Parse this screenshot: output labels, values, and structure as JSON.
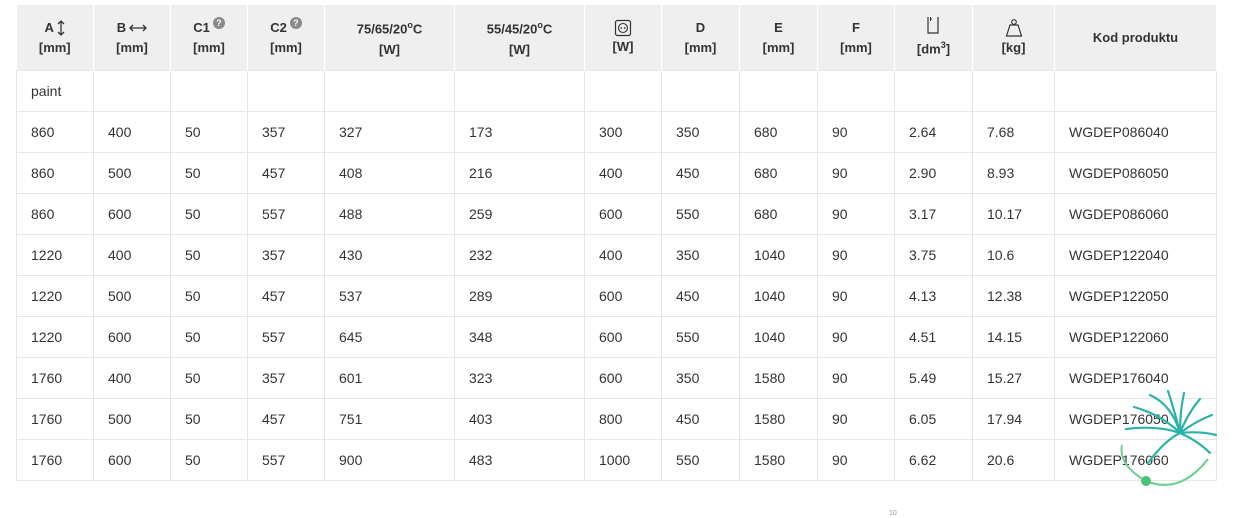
{
  "header": {
    "a_label": "A",
    "b_label": "B",
    "c1_label": "C1",
    "c2_label": "C2",
    "p75_label": "75/65/20",
    "p75_sup": "o",
    "p75_suffix": "C",
    "p55_label": "55/45/20",
    "p55_sup": "o",
    "p55_suffix": "C",
    "d_label": "D",
    "e_label": "E",
    "f_label": "F",
    "vol_sup": "3",
    "kod_label": "Kod produktu",
    "unit_mm": "[mm]",
    "unit_w": "[W]",
    "unit_dm": "[dm",
    "unit_dm_close": "]",
    "unit_kg": "[kg]",
    "help_glyph": "?"
  },
  "section": {
    "label": "paint"
  },
  "rows": [
    [
      "860",
      "400",
      "50",
      "357",
      "327",
      "173",
      "300",
      "350",
      "680",
      "90",
      "2.64",
      "7.68",
      "WGDEP086040"
    ],
    [
      "860",
      "500",
      "50",
      "457",
      "408",
      "216",
      "400",
      "450",
      "680",
      "90",
      "2.90",
      "8.93",
      "WGDEP086050"
    ],
    [
      "860",
      "600",
      "50",
      "557",
      "488",
      "259",
      "600",
      "550",
      "680",
      "90",
      "3.17",
      "10.17",
      "WGDEP086060"
    ],
    [
      "1220",
      "400",
      "50",
      "357",
      "430",
      "232",
      "400",
      "350",
      "1040",
      "90",
      "3.75",
      "10.6",
      "WGDEP122040"
    ],
    [
      "1220",
      "500",
      "50",
      "457",
      "537",
      "289",
      "600",
      "450",
      "1040",
      "90",
      "4.13",
      "12.38",
      "WGDEP122050"
    ],
    [
      "1220",
      "600",
      "50",
      "557",
      "645",
      "348",
      "600",
      "550",
      "1040",
      "90",
      "4.51",
      "14.15",
      "WGDEP122060"
    ],
    [
      "1760",
      "400",
      "50",
      "357",
      "601",
      "323",
      "600",
      "350",
      "1580",
      "90",
      "5.49",
      "15.27",
      "WGDEP176040"
    ],
    [
      "1760",
      "500",
      "50",
      "457",
      "751",
      "403",
      "800",
      "450",
      "1580",
      "90",
      "6.05",
      "17.94",
      "WGDEP176050"
    ],
    [
      "1760",
      "600",
      "50",
      "557",
      "900",
      "483",
      "1000",
      "550",
      "1580",
      "90",
      "6.62",
      "20.6",
      "WGDEP176060"
    ]
  ],
  "footnote": "10",
  "colors": {
    "header_bg": "#efefef",
    "border": "#e6e6e6",
    "logo_teal": "#2bb3a8",
    "logo_green": "#4cc17a"
  }
}
